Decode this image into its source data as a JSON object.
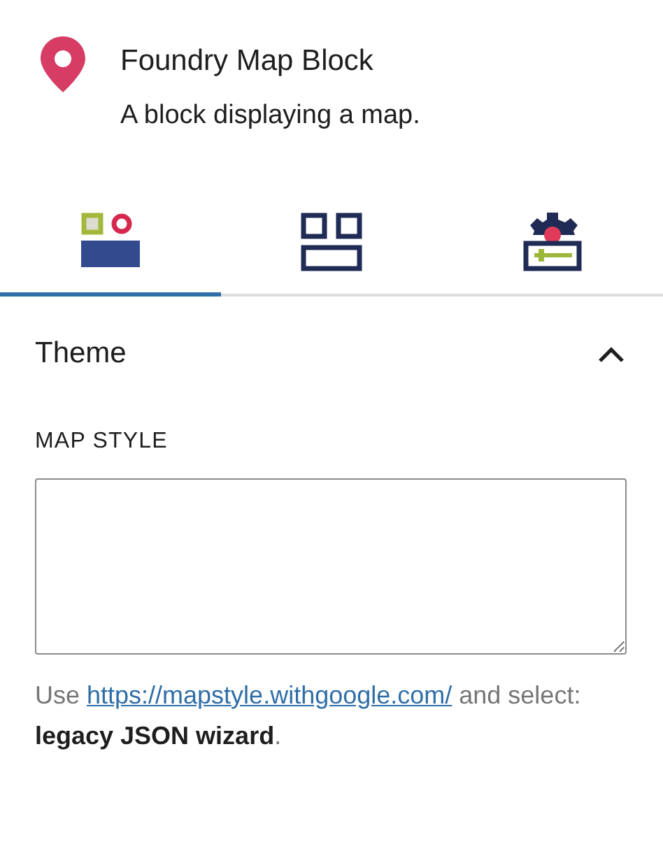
{
  "block": {
    "title": "Foundry Map Block",
    "description": "A block displaying a map."
  },
  "tabs": [
    {
      "kind": "style",
      "selected": true
    },
    {
      "kind": "layout",
      "selected": false
    },
    {
      "kind": "settings",
      "selected": false
    }
  ],
  "panel": {
    "title": "Theme",
    "expanded": true,
    "field": {
      "label": "MAP STYLE"
    },
    "help": {
      "before": "Use ",
      "link": "https://mapstyle.withgoogle.com/",
      "after": " and select:\n**legacy JSON wizard**."
    }
  }
}
